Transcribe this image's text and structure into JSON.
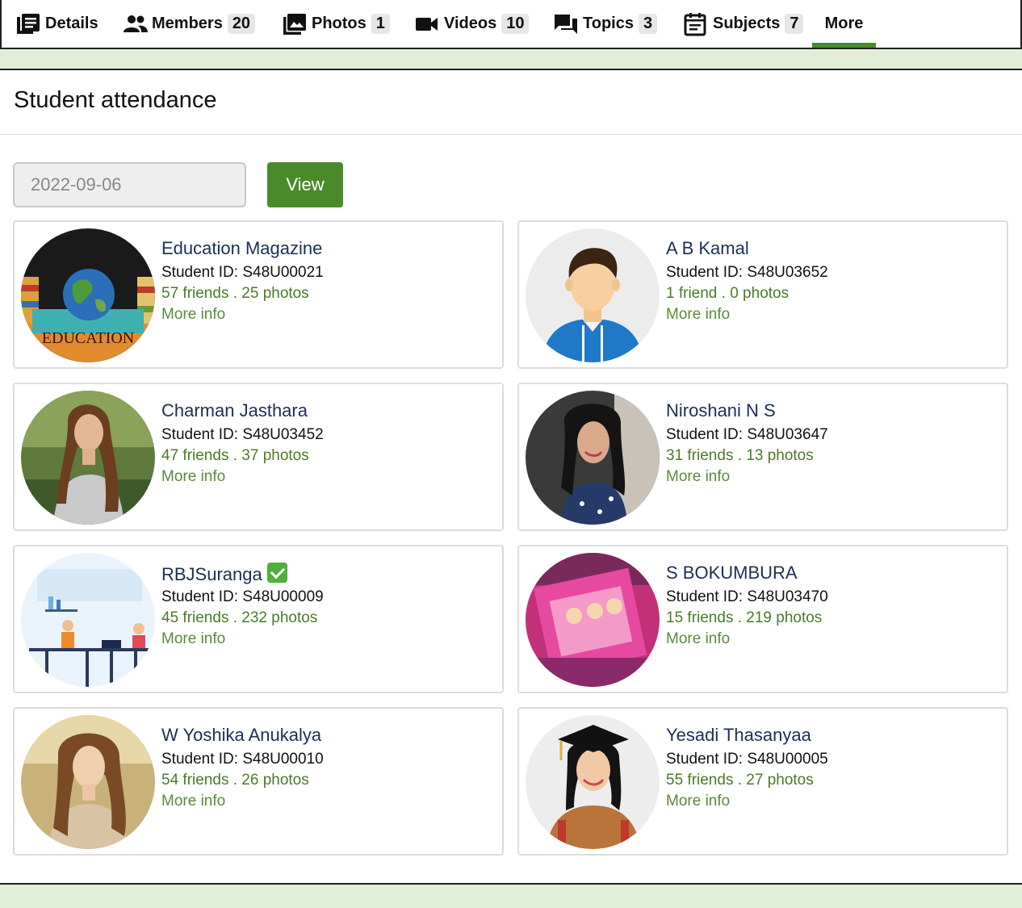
{
  "tabs": [
    {
      "label": "Details",
      "icon": "details-icon",
      "count": null
    },
    {
      "label": "Members",
      "icon": "members-icon",
      "count": "20"
    },
    {
      "label": "Photos",
      "icon": "photos-icon",
      "count": "1"
    },
    {
      "label": "Videos",
      "icon": "videos-icon",
      "count": "10"
    },
    {
      "label": "Topics",
      "icon": "topics-icon",
      "count": "3"
    },
    {
      "label": "Subjects",
      "icon": "subjects-icon",
      "count": "7"
    },
    {
      "label": "More",
      "icon": null,
      "count": null,
      "active": true
    }
  ],
  "page": {
    "title": "Student attendance"
  },
  "filter": {
    "date_value": "2022-09-06",
    "view_label": "View"
  },
  "colors": {
    "accent": "#4a8a2a",
    "band": "#e1efd9",
    "name": "#1c2f55",
    "stats": "#4a7a2a"
  },
  "students": [
    {
      "name": "Education Magazine",
      "id_label": "Student ID: S48U00021",
      "stats": "57 friends . 25 photos",
      "more": "More info",
      "avatar": "education-globe",
      "avatar_text": "EDUCATION"
    },
    {
      "name": "A B Kamal",
      "id_label": "Student ID: S48U03652",
      "stats": "1 friend . 0 photos",
      "more": "More info",
      "avatar": "default-male"
    },
    {
      "name": "Charman Jasthara",
      "id_label": "Student ID: S48U03452",
      "stats": "47 friends . 37 photos",
      "more": "More info",
      "avatar": "woman-outdoor"
    },
    {
      "name": "Niroshani N S",
      "id_label": "Student ID: S48U03647",
      "stats": "31 friends . 13 photos",
      "more": "More info",
      "avatar": "woman-selfie"
    },
    {
      "name": "RBJSuranga",
      "id_label": "Student ID: S48U00009",
      "stats": "45 friends . 232 photos",
      "more": "More info",
      "avatar": "classroom-illustration",
      "verified": true
    },
    {
      "name": "S BOKUMBURA",
      "id_label": "Student ID: S48U03470",
      "stats": "15 friends . 219 photos",
      "more": "More info",
      "avatar": "pink-toys"
    },
    {
      "name": "W Yoshika Anukalya",
      "id_label": "Student ID: S48U00010",
      "stats": "54 friends . 26 photos",
      "more": "More info",
      "avatar": "woman-portrait"
    },
    {
      "name": "Yesadi Thasanyaa",
      "id_label": "Student ID: S48U00005",
      "stats": "55 friends . 27 photos",
      "more": "More info",
      "avatar": "graduate"
    }
  ]
}
